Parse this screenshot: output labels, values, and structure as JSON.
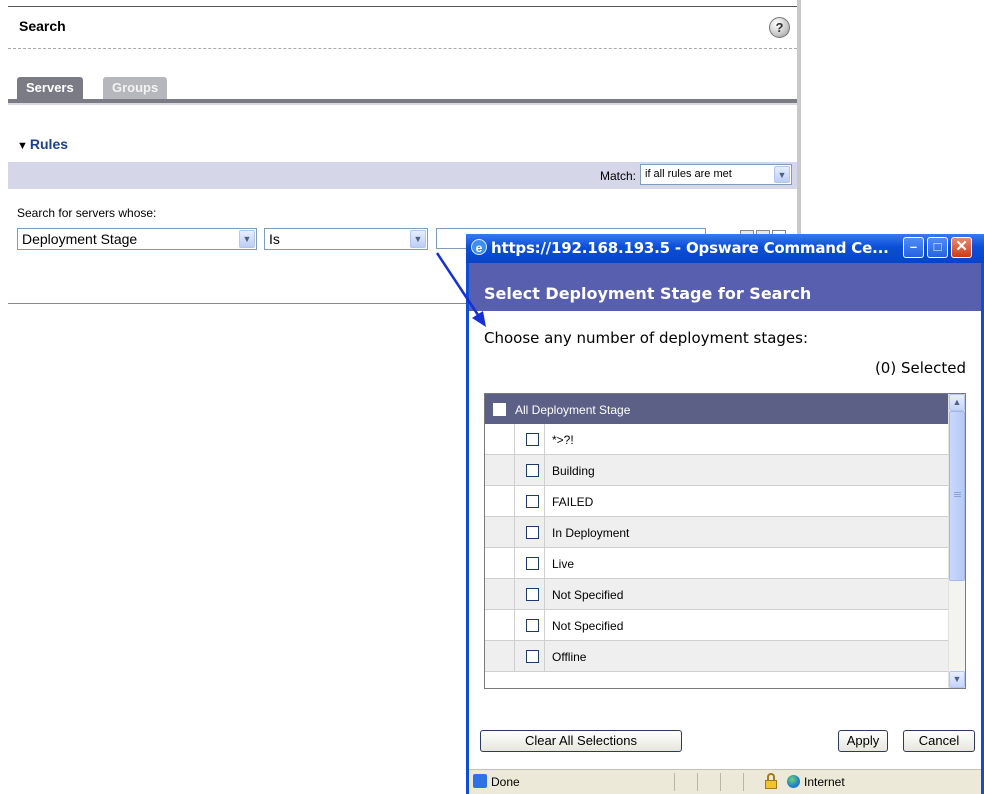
{
  "search_panel": {
    "title": "Search",
    "help_symbol": "?",
    "tabs": [
      {
        "label": "Servers",
        "selected": true
      },
      {
        "label": "Groups",
        "selected": false
      }
    ],
    "rules_toggle_symbol": "▼",
    "rules_heading": "Rules",
    "match_label": "Match:",
    "match_value": "if all rules are met",
    "search_for_label": "Search for servers whose:",
    "field_select_value": "Deployment Stage",
    "operator_select_value": "Is",
    "value_input": ""
  },
  "popup": {
    "window_title": "https://192.168.193.5 - Opsware Command Ce...",
    "header": "Select Deployment Stage for Search",
    "instruction": "Choose any number of deployment stages:",
    "selected_count": "(0) Selected",
    "list_header": "All Deployment Stage",
    "items": [
      "*>?!",
      "Building",
      "FAILED",
      "In Deployment",
      "Live",
      "Not Specified",
      "Not Specified",
      "Offline"
    ],
    "buttons": {
      "clear_all": "Clear All Selections",
      "apply": "Apply",
      "cancel": "Cancel"
    },
    "status": {
      "text": "Done",
      "zone": "Internet"
    }
  },
  "icons": {
    "dropdown": "chevron-down-icon",
    "help": "help-icon",
    "window_close": "close-icon",
    "lock": "lock-icon",
    "globe": "globe-icon"
  },
  "colors": {
    "titlebar": "#0a4fd8",
    "popup_header": "#575fae",
    "list_header": "#5c6087",
    "rules_heading": "#1e3f8f",
    "match_bar": "#d5d6e7",
    "arrow": "#1430d6"
  }
}
